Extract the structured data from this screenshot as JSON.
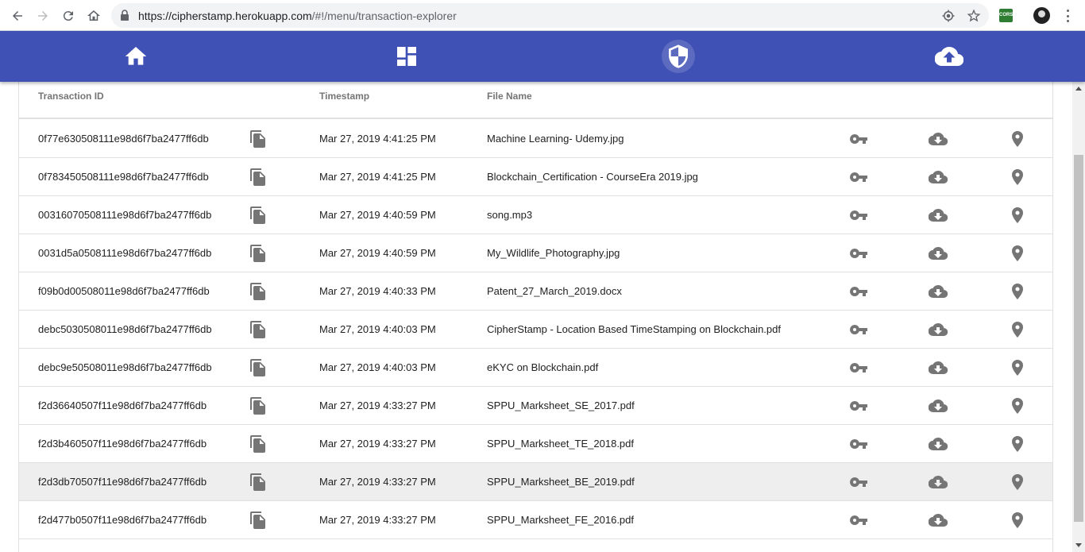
{
  "browser": {
    "url_host": "https://cipherstamp.herokuapp.com",
    "url_path": "/#!/menu/transaction-explorer",
    "extension_label": "CORS"
  },
  "appbar": {
    "items": [
      {
        "name": "home",
        "icon": "home-icon"
      },
      {
        "name": "dashboard",
        "icon": "dashboard-icon"
      },
      {
        "name": "security",
        "icon": "shield-icon",
        "active": true
      },
      {
        "name": "upload",
        "icon": "cloud-upload-icon"
      }
    ],
    "background": "#3f51b5"
  },
  "table": {
    "headers": {
      "transaction_id": "Transaction ID",
      "timestamp": "Timestamp",
      "file_name": "File Name"
    },
    "rows": [
      {
        "id": "0f77e630508111e98d6f7ba2477ff6db",
        "timestamp": "Mar 27, 2019 4:41:25 PM",
        "file": "Machine Learning- Udemy.jpg"
      },
      {
        "id": "0f783450508111e98d6f7ba2477ff6db",
        "timestamp": "Mar 27, 2019 4:41:25 PM",
        "file": "Blockchain_Certification - CourseEra 2019.jpg"
      },
      {
        "id": "00316070508111e98d6f7ba2477ff6db",
        "timestamp": "Mar 27, 2019 4:40:59 PM",
        "file": "song.mp3"
      },
      {
        "id": "0031d5a0508111e98d6f7ba2477ff6db",
        "timestamp": "Mar 27, 2019 4:40:59 PM",
        "file": "My_Wildlife_Photography.jpg"
      },
      {
        "id": "f09b0d00508011e98d6f7ba2477ff6db",
        "timestamp": "Mar 27, 2019 4:40:33 PM",
        "file": "Patent_27_March_2019.docx"
      },
      {
        "id": "debc5030508011e98d6f7ba2477ff6db",
        "timestamp": "Mar 27, 2019 4:40:03 PM",
        "file": "CipherStamp - Location Based TimeStamping on Blockchain.pdf"
      },
      {
        "id": "debc9e50508011e98d6f7ba2477ff6db",
        "timestamp": "Mar 27, 2019 4:40:03 PM",
        "file": "eKYC on Blockchain.pdf"
      },
      {
        "id": "f2d36640507f11e98d6f7ba2477ff6db",
        "timestamp": "Mar 27, 2019 4:33:27 PM",
        "file": "SPPU_Marksheet_SE_2017.pdf"
      },
      {
        "id": "f2d3b460507f11e98d6f7ba2477ff6db",
        "timestamp": "Mar 27, 2019 4:33:27 PM",
        "file": "SPPU_Marksheet_TE_2018.pdf"
      },
      {
        "id": "f2d3db70507f11e98d6f7ba2477ff6db",
        "timestamp": "Mar 27, 2019 4:33:27 PM",
        "file": "SPPU_Marksheet_BE_2019.pdf",
        "hover": true
      },
      {
        "id": "f2d477b0507f11e98d6f7ba2477ff6db",
        "timestamp": "Mar 27, 2019 4:33:27 PM",
        "file": "SPPU_Marksheet_FE_2016.pdf"
      }
    ]
  }
}
